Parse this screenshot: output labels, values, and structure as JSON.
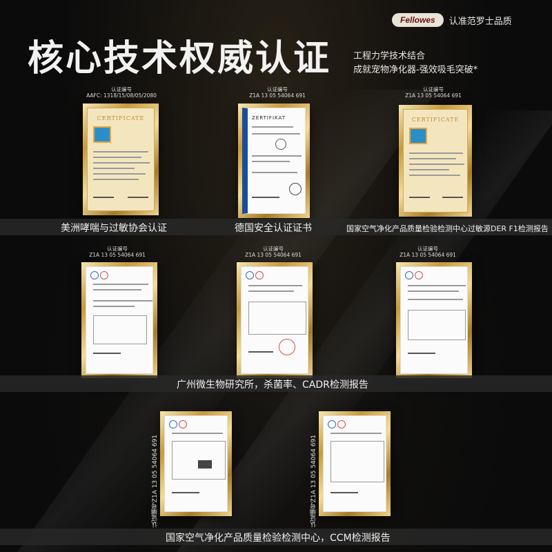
{
  "header": {
    "title": "核心技术权威认证",
    "subtitle_line1": "工程力学技术结合",
    "subtitle_line2": "成就宠物净化器-强效吸毛突破*"
  },
  "brand": {
    "logo": "Fellowes",
    "slogan": "认准范罗士品质"
  },
  "certificates": [
    {
      "id_label": "认证编号",
      "id": "AAFC: 1318/15/08/05/2080",
      "caption": "美洲哮喘与过敏协会认证",
      "cert_title": "CERTIFICATE"
    },
    {
      "id_label": "认证编号",
      "id": "Z1A 13 05 54064 691",
      "caption": "德国安全认证证书",
      "cert_title": "ZERTIFIKAT"
    },
    {
      "id_label": "认证编号",
      "id": "Z1A 13 05 54064 691",
      "caption": "国家空气净化产品质量检验检测中心过敏源DER F1检测报告",
      "cert_title": "CERTIFICATE"
    },
    {
      "id_label": "认证编号",
      "id": "Z1A 13 05 54064 691"
    },
    {
      "id_label": "认证编号",
      "id": "Z1A 13 05 54064 691"
    },
    {
      "id_label": "认证编号",
      "id": "Z1A 13 05 54064 691"
    },
    {
      "side_id": "认证编号Z1A 13 05 54064 691"
    },
    {
      "side_id": "认证编号Z1A 13 05 54064 691"
    }
  ],
  "captions": {
    "row2": "广州微生物研究所，杀菌率、CADR检测报告",
    "row3": "国家空气净化产品质量检验检测中心，CCM检测报告"
  }
}
